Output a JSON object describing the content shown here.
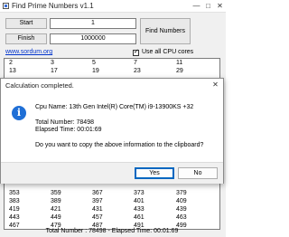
{
  "app": {
    "title": "Find Prime Numbers v1.1",
    "start_label": "Start",
    "start_value": "1",
    "finish_label": "Finish",
    "finish_value": "1000000",
    "find_button": "Find Numbers",
    "site_link": "www.sordum.org",
    "cpu_checkbox_label": "Use all CPU cores",
    "cpu_checkbox_checked": true,
    "titlebar_buttons": {
      "minimize": "—",
      "maximize": "□",
      "close": "✕"
    }
  },
  "results": {
    "top_rows": [
      [
        "2",
        "3",
        "5",
        "7",
        "11"
      ],
      [
        "13",
        "17",
        "19",
        "23",
        "29"
      ]
    ],
    "bottom_rows": [
      [
        "353",
        "359",
        "367",
        "373",
        "379"
      ],
      [
        "383",
        "389",
        "397",
        "401",
        "409"
      ],
      [
        "419",
        "421",
        "431",
        "433",
        "439"
      ],
      [
        "443",
        "449",
        "457",
        "461",
        "463"
      ],
      [
        "467",
        "479",
        "487",
        "491",
        "499"
      ]
    ]
  },
  "status": {
    "text": "Total Number : 78498 - Elapsed Time: 00:01:69"
  },
  "dialog": {
    "title": "Calculation completed.",
    "close": "✕",
    "icon": "info-icon",
    "icon_glyph": "i",
    "cpu_line": "Cpu Name: 13th Gen Intel(R) Core(TM) i9-13900KS +32",
    "total_line": "Total Number: 78498",
    "elapsed_line": "Elapsed Time: 00:01:69",
    "question": "Do you want to copy the above information to the clipboard?",
    "yes": "Yes",
    "no": "No"
  },
  "colors": {
    "accent": "#0067c0",
    "info_icon": "#1f6fd6",
    "link": "#0033cc"
  }
}
